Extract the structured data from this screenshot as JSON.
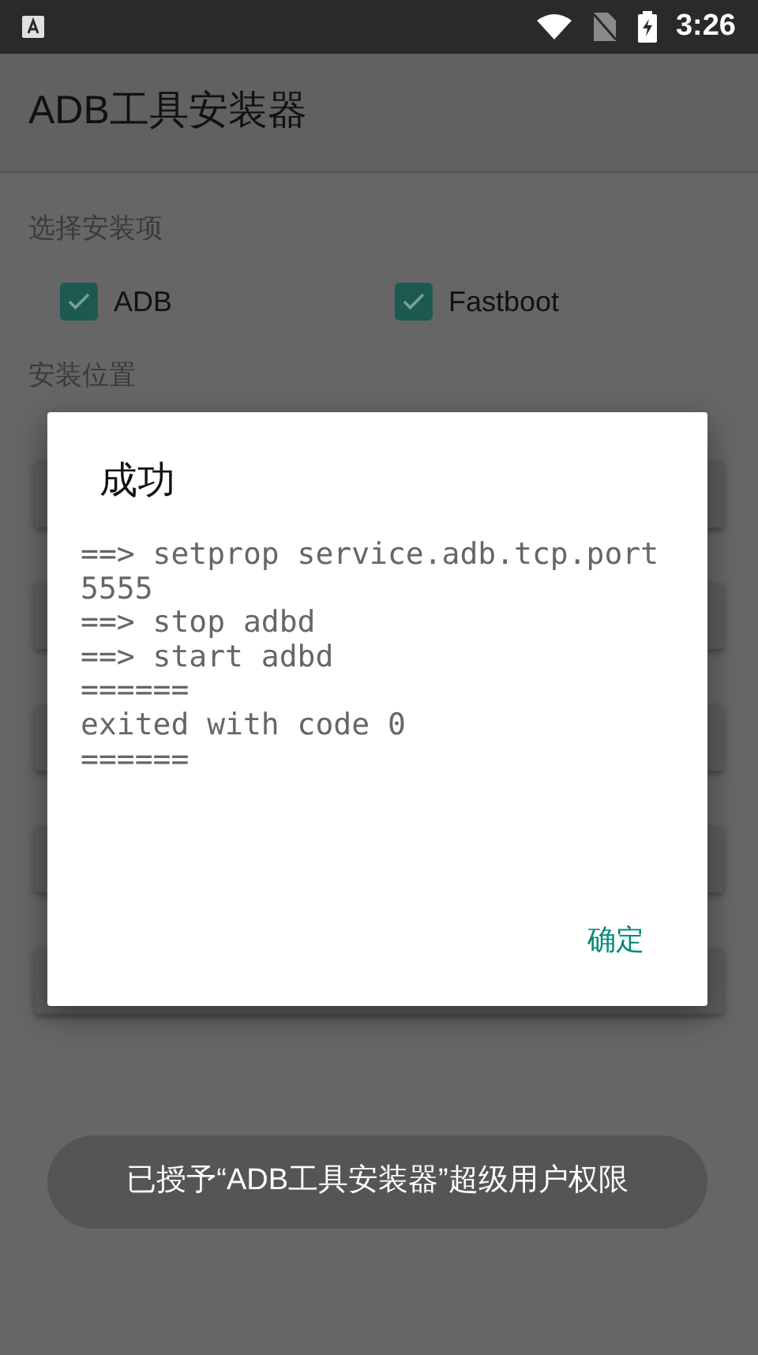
{
  "status_bar": {
    "time": "3:26"
  },
  "app_bar": {
    "title": "ADB工具安装器"
  },
  "install_items": {
    "label": "选择安装项",
    "options": [
      {
        "label": "ADB",
        "checked": true
      },
      {
        "label": "Fastboot",
        "checked": true
      }
    ]
  },
  "install_location": {
    "label": "安装位置"
  },
  "dialog": {
    "title": "成功",
    "output": "==> setprop service.adb.tcp.port 5555\n==> stop adbd\n==> start adbd\n======\nexited with code 0\n======",
    "buttons": [
      "确定"
    ]
  },
  "toast": {
    "message": "已授予“ADB工具安装器”超级用户权限"
  }
}
